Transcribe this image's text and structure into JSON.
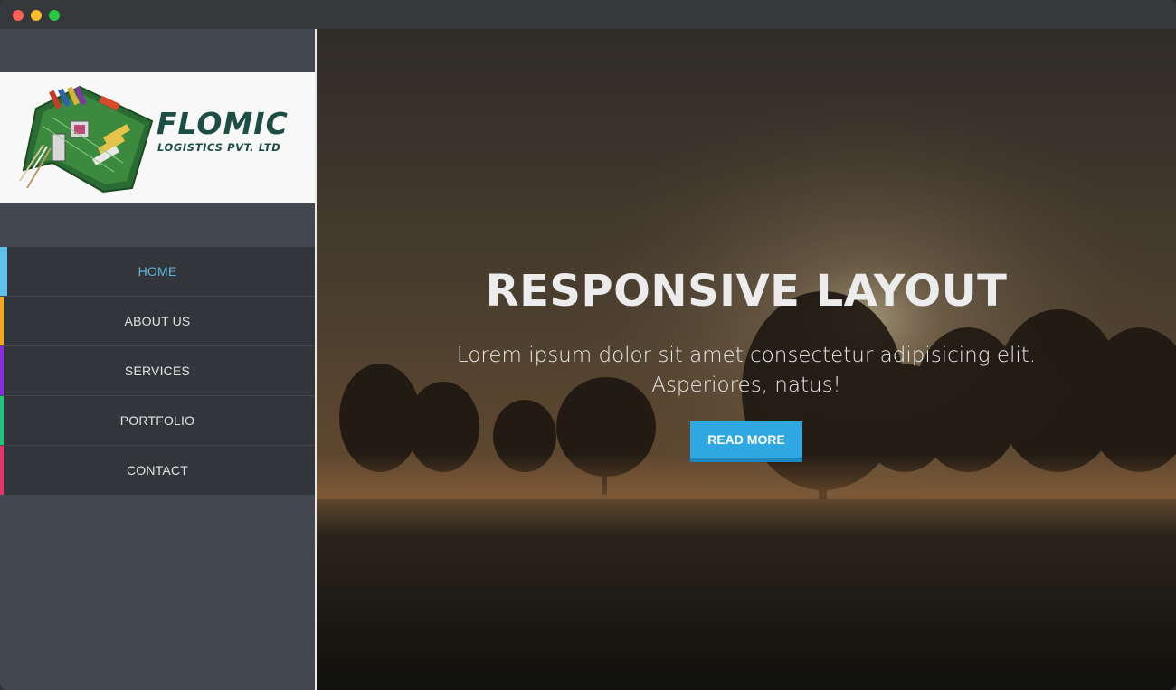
{
  "window": {
    "controls": [
      "close",
      "minimize",
      "maximize"
    ]
  },
  "logo": {
    "name": "FLOMIC",
    "subtitle": "LOGISTICS PVT. LTD",
    "icon": "circuit-board-icon"
  },
  "nav": {
    "items": [
      {
        "label": "HOME",
        "active": true,
        "accent": "#5fc0ec"
      },
      {
        "label": "ABOUT US",
        "active": false,
        "accent": "#f4a61c"
      },
      {
        "label": "SERVICES",
        "active": false,
        "accent": "#8a2be2"
      },
      {
        "label": "PORTFOLIO",
        "active": false,
        "accent": "#1ec878"
      },
      {
        "label": "CONTACT",
        "active": false,
        "accent": "#e8336a"
      }
    ]
  },
  "hero": {
    "title": "RESPONSIVE LAYOUT",
    "text": "Lorem ipsum dolor sit amet consectetur adipisicing elit. Asperiores, natus!",
    "button_label": "READ MORE"
  },
  "colors": {
    "sidebar_bg": "#43474f",
    "nav_bg": "#32363b",
    "active_text": "#5fb6e0",
    "button": "#2fa8e2",
    "logo_text": "#1d4e45"
  }
}
